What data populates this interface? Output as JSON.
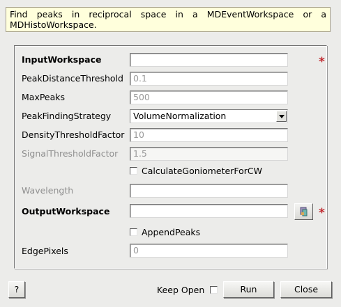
{
  "description": "Find peaks in reciprocal space in a MDEventWorkspace or a MDHistoWorkspace.",
  "properties": {
    "input_workspace": {
      "label": "InputWorkspace",
      "value": ""
    },
    "peak_distance_threshold": {
      "label": "PeakDistanceThreshold",
      "value": "0.1"
    },
    "max_peaks": {
      "label": "MaxPeaks",
      "value": "500"
    },
    "peak_finding_strategy": {
      "label": "PeakFindingStrategy",
      "value": "VolumeNormalization"
    },
    "density_threshold_factor": {
      "label": "DensityThresholdFactor",
      "value": "10"
    },
    "signal_threshold_factor": {
      "label": "SignalThresholdFactor",
      "value": "1.5"
    },
    "calculate_goniometer": {
      "label": "CalculateGoniometerForCW",
      "checked": false
    },
    "wavelength": {
      "label": "Wavelength",
      "value": ""
    },
    "output_workspace": {
      "label": "OutputWorkspace",
      "value": ""
    },
    "append_peaks": {
      "label": "AppendPeaks",
      "checked": false
    },
    "edge_pixels": {
      "label": "EdgePixels",
      "value": "0"
    }
  },
  "required_marker": "*",
  "footer": {
    "help_label": "?",
    "keep_open_label": "Keep Open",
    "keep_open_checked": false,
    "run_label": "Run",
    "close_label": "Close"
  },
  "colors": {
    "required": "#c1272d",
    "description_bg": "#ffffdc"
  }
}
